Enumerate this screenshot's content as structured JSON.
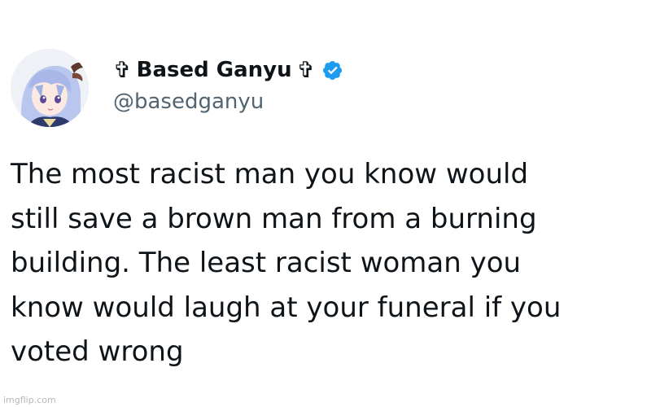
{
  "tweet": {
    "avatar": {
      "description_icon": "anime-avatar-icon"
    },
    "display_name": "Based Ganyu",
    "cross_symbol": "✞",
    "handle": "@basedganyu",
    "verified_icon": "verified-badge-icon",
    "body_lines": [
      "The most racist man you know would",
      "still save a brown man from a burning",
      "building. The least racist woman you",
      "know would laugh at your funeral if you",
      "voted wrong"
    ]
  },
  "watermark": "imgflip.com",
  "colors": {
    "text_primary": "#0f1419",
    "text_secondary": "#536471",
    "verified_blue": "#1d9bf0",
    "background": "#ffffff"
  }
}
